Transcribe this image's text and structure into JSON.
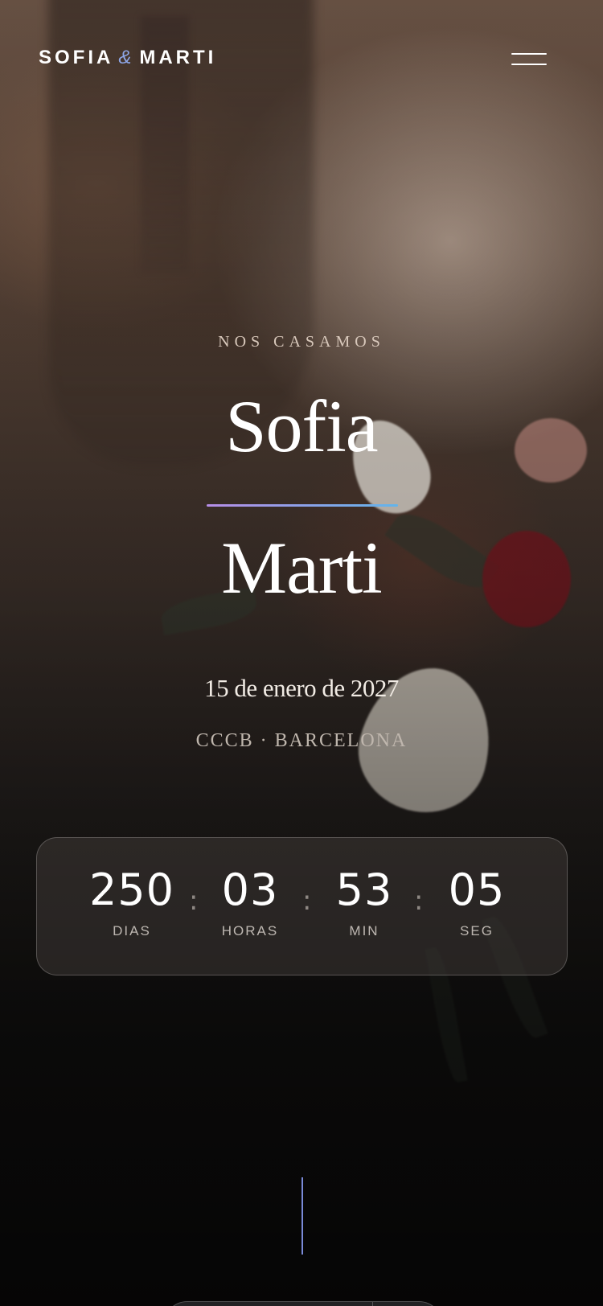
{
  "header": {
    "brand_first": "SOFIA",
    "brand_amp": "&",
    "brand_second": "MARTI",
    "menu_icon": "hamburger-menu-icon"
  },
  "hero": {
    "eyebrow": "NOS CASAMOS",
    "name_one": "Sofia",
    "name_two": "Marti",
    "date": "15 de enero de 2027",
    "venue": "CCCB · BARCELONA"
  },
  "countdown": {
    "days": {
      "value": "250",
      "label": "DIAS"
    },
    "hours": {
      "value": "03",
      "label": "HORAS"
    },
    "minutes": {
      "value": "53",
      "label": "MIN"
    },
    "seconds": {
      "value": "05",
      "label": "SEG"
    },
    "separator": ":"
  },
  "dock": {
    "text_icon": "A",
    "icons": [
      "text-size-icon",
      "celebration-icon",
      "minus-icon",
      "settings-icon"
    ]
  },
  "colors": {
    "accent_start": "#b78ee8",
    "accent_end": "#62b4ea",
    "amp": "#8ea7e8",
    "notification_dot": "#d94b7a"
  }
}
